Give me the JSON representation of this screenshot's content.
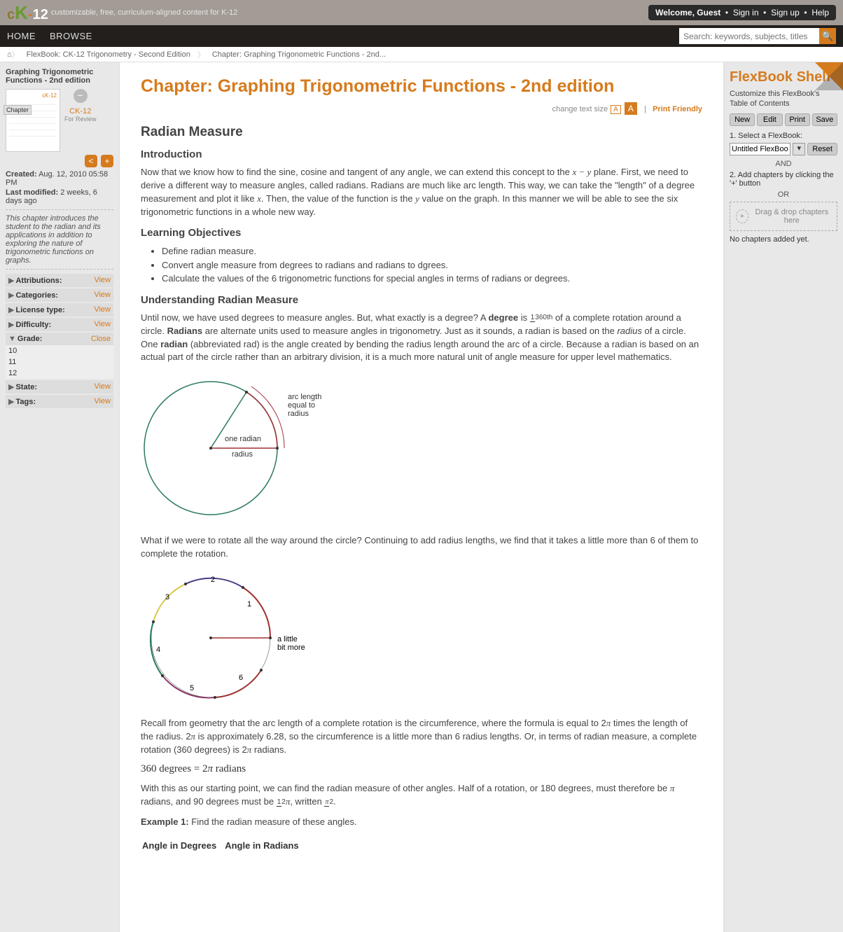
{
  "topbar": {
    "tagline": "customizable, free, curriculum-aligned content for K-12",
    "welcome": "Welcome, Guest",
    "signin": "Sign in",
    "signup": "Sign up",
    "help": "Help"
  },
  "nav": {
    "home": "HOME",
    "browse": "BROWSE",
    "search_placeholder": "Search: keywords, subjects, titles"
  },
  "breadcrumb": {
    "item1": "FlexBook: CK-12 Trigonometry - Second Edition",
    "item2": "Chapter: Graphing Trigonometric Functions - 2nd..."
  },
  "left": {
    "title": "Graphing Trigonometric Functions - 2nd edition",
    "chapter_label": "Chapter",
    "ck12": "CK-12",
    "for_review": "For Review",
    "created_label": "Created:",
    "created": "Aug. 12, 2010 05:58 PM",
    "modified_label": "Last modified:",
    "modified": "2 weeks, 6 days ago",
    "desc": "This chapter introduces the student to the radian and its applications in addition to exploring the nature of trigonometric functions on graphs.",
    "attrs": [
      {
        "label": "Attributions:",
        "action": "View"
      },
      {
        "label": "Categories:",
        "action": "View"
      },
      {
        "label": "License type:",
        "action": "View"
      },
      {
        "label": "Difficulty:",
        "action": "View"
      }
    ],
    "grade_label": "Grade:",
    "grade_action": "Close",
    "grades": [
      "10",
      "11",
      "12"
    ],
    "state": {
      "label": "State:",
      "action": "View"
    },
    "tags": {
      "label": "Tags:",
      "action": "View"
    }
  },
  "content": {
    "h1": "Chapter: Graphing Trigonometric Functions - 2nd edition",
    "textsize": "change text size",
    "a_small": "A",
    "a_big": "A",
    "print": "Print Friendly",
    "h2_1": "Radian Measure",
    "h3_intro": "Introduction",
    "p_intro": "Now that we know how to find the sine, cosine and tangent of any angle, we can extend this concept to the x − y plane. First, we need to derive a different way to measure angles, called radians. Radians are much like arc length. This way, we can take the \"length\" of a degree measurement and plot it like x. Then, the value of the function is the y value on the graph. In this manner we will be able to see the six trigonometric functions in a whole new way.",
    "h3_obj": "Learning Objectives",
    "obj": [
      "Define radian measure.",
      "Convert angle measure from degrees to radians and radians to dgrees.",
      "Calculate the values of the 6 trigonometric functions for special angles in terms of radians or degrees."
    ],
    "h3_und": "Understanding Radian Measure",
    "p_und1a": "Until now, we have used degrees to measure angles. But, what exactly is a degree? A ",
    "degree_bold": "degree",
    "p_und1b": " is ",
    "frac_top": "1",
    "frac_bot": "360th",
    "p_und1c": " of a complete rotation around a circle. ",
    "radians_bold": "Radians",
    "p_und1d": " are alternate units used to measure angles in trigonometry. Just as it sounds, a radian is based on the ",
    "radius_ital": "radius",
    "p_und1e": " of a circle. One ",
    "radian_bold": "radian",
    "p_und1f": " (abbreviated rad) is the angle created by bending the radius length around the arc of a circle. Because a radian is based on an actual part of the circle rather than an arbitrary division, it is a much more natural unit of angle measure for upper level mathematics.",
    "fig1_arc": "arc length equal to radius",
    "fig1_one": "one radian",
    "fig1_rad": "radius",
    "p_rot": "What if we were to rotate all the way around the circle? Continuing to add radius lengths, we find that it takes a little more than 6 of them to complete the rotation.",
    "fig2_little": "a little bit more",
    "p_recall": "Recall from geometry that the arc length of a complete rotation is the circumference, where the formula is equal to 2π times the length of the radius. 2π is approximately 6.28, so the circumference is a little more than 6 radius lengths. Or, in terms of radian measure, a complete rotation (360 degrees) is 2π radians.",
    "eq": "360 degrees = 2π radians",
    "p_half": "With this as our starting point, we can find the radian measure of other angles. Half of a rotation, or 180 degrees, must therefore be π radians, and 90 degrees must be ½π, written π/2.",
    "ex1_label": "Example 1:",
    "ex1_text": " Find the radian measure of these angles.",
    "th1": "Angle in Degrees",
    "th2": "Angle in Radians"
  },
  "right": {
    "title": "FlexBook Shelf",
    "subtitle": "Customize this FlexBook's Table of Contents",
    "btns": [
      "New",
      "Edit",
      "Print",
      "Save"
    ],
    "step1": "1. Select a FlexBook:",
    "untitled": "Untitled FlexBook",
    "reset": "Reset",
    "and": "AND",
    "step2": "2. Add chapters by clicking the '+' button",
    "or": "OR",
    "drop": "Drag & drop chapters here",
    "none": "No chapters added yet."
  }
}
